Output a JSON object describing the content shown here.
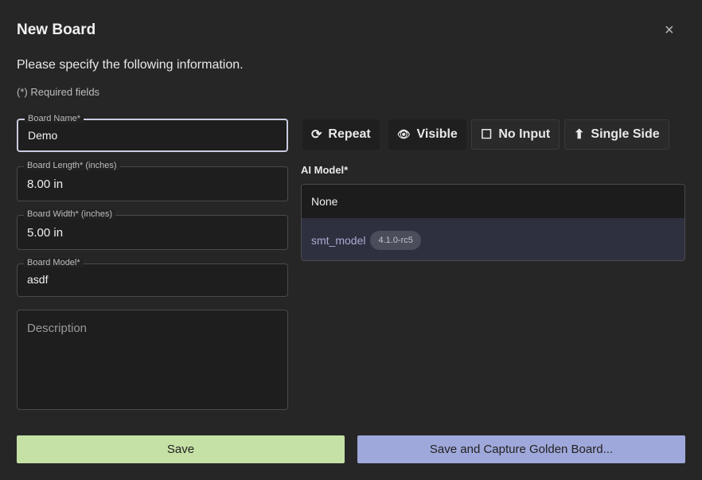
{
  "dialog": {
    "title": "New Board",
    "close_icon": "×",
    "intro": "Please specify the following information.",
    "required_note": "(*) Required fields"
  },
  "fields": {
    "board_name": {
      "label": "Board Name*",
      "value": "Demo"
    },
    "board_length": {
      "label": "Board Length* (inches)",
      "value": "8.00 in"
    },
    "board_width": {
      "label": "Board Width* (inches)",
      "value": "5.00 in"
    },
    "board_model": {
      "label": "Board Model*",
      "value": "asdf"
    },
    "description": {
      "placeholder": "Description"
    }
  },
  "toggles": [
    {
      "label": "Repeat",
      "icon": "⟳"
    },
    {
      "label": "Visible",
      "icon": "👁"
    },
    {
      "label": "No Input",
      "icon": "☐"
    },
    {
      "label": "Single Side",
      "icon": "⬆"
    }
  ],
  "ai_model": {
    "label": "AI Model*",
    "options": [
      {
        "label": "None"
      },
      {
        "label": "smt_model",
        "version": "4.1.0-rc5"
      }
    ]
  },
  "actions": {
    "save": "Save",
    "save_capture": "Save and Capture Golden Board..."
  }
}
